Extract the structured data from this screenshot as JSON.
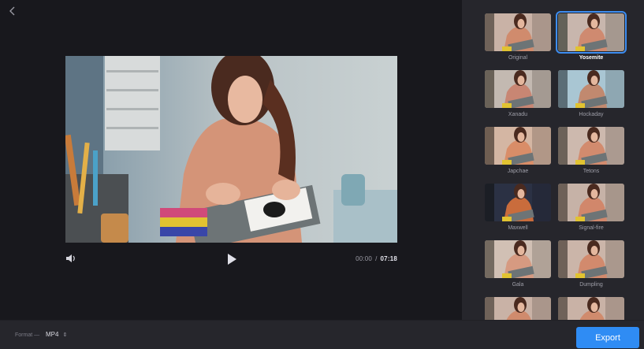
{
  "nav": {
    "back_icon": "chevron-left-icon"
  },
  "player": {
    "current_time": "00:00",
    "separator": "/",
    "total_time": "07:18",
    "volume_icon": "speaker-icon",
    "play_icon": "play-icon"
  },
  "filters": [
    {
      "label": "Original",
      "selected": false
    },
    {
      "label": "Yosemite",
      "selected": true
    },
    {
      "label": "Xanadu",
      "selected": false
    },
    {
      "label": "Hockaday",
      "selected": false
    },
    {
      "label": "Japchae",
      "selected": false
    },
    {
      "label": "Tetons",
      "selected": false
    },
    {
      "label": "Maxwell",
      "selected": false
    },
    {
      "label": "Signal-fire",
      "selected": false
    },
    {
      "label": "Gala",
      "selected": false
    },
    {
      "label": "Dumpling",
      "selected": false
    },
    {
      "label": "",
      "selected": false
    },
    {
      "label": "",
      "selected": false
    }
  ],
  "footer": {
    "format_label": "Format —",
    "format_value": "MP4",
    "export_label": "Export"
  },
  "colors": {
    "accent": "#2f8cf4",
    "background": "#18181d",
    "panel": "#26262c"
  }
}
